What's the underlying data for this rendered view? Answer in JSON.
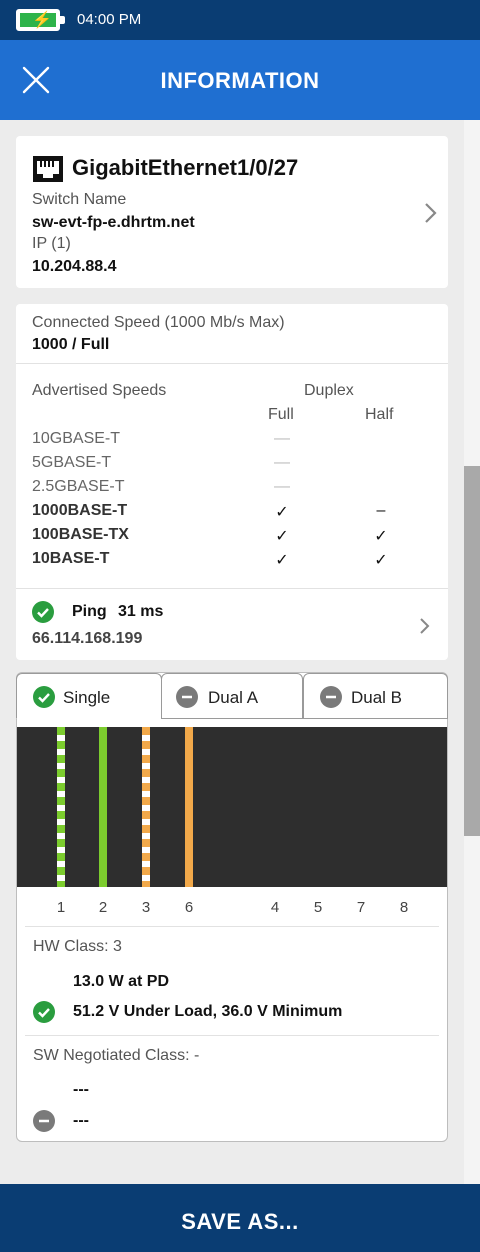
{
  "status_bar": {
    "time": "04:00 PM",
    "battery_icon": "battery-charging-icon"
  },
  "app_bar": {
    "title": "INFORMATION",
    "close_icon": "close-icon"
  },
  "port_card": {
    "port_name": "GigabitEthernet1/0/27",
    "switch_name_label": "Switch Name",
    "switch_name": "sw-evt-fp-e.dhrtm.net",
    "ip_label": "IP (1)",
    "ip": "10.204.88.4"
  },
  "speed_card": {
    "connected_speed_label": "Connected Speed (1000 Mb/s Max)",
    "connected_speed": "1000 / Full",
    "advertised_label": "Advertised Speeds",
    "duplex_label": "Duplex",
    "full_label": "Full",
    "half_label": "Half",
    "rows": [
      {
        "name": "10GBASE-T",
        "full": "—",
        "half": ""
      },
      {
        "name": "5GBASE-T",
        "full": "—",
        "half": ""
      },
      {
        "name": "2.5GBASE-T",
        "full": "—",
        "half": ""
      },
      {
        "name": "1000BASE-T",
        "full": "✓",
        "half": "–"
      },
      {
        "name": "100BASE-TX",
        "full": "✓",
        "half": "✓"
      },
      {
        "name": "10BASE-T",
        "full": "✓",
        "half": "✓"
      }
    ],
    "ping_label": "Ping",
    "ping_value": "31 ms",
    "ping_ip": "66.114.168.199"
  },
  "poe_card": {
    "tabs": [
      {
        "label": "Single",
        "status": "ok"
      },
      {
        "label": "Dual A",
        "status": "none"
      },
      {
        "label": "Dual B",
        "status": "none"
      }
    ],
    "pins": [
      "1",
      "2",
      "3",
      "6",
      "4",
      "5",
      "7",
      "8"
    ],
    "wire_colors": {
      "green": "#7ccc2e",
      "orange": "#f2a94a",
      "white": "#ffffff"
    },
    "hw_class_label": "HW Class: 3",
    "hw_power": "13.0 W at PD",
    "hw_voltage": "51.2 V Under Load, 36.0 V Minimum",
    "sw_class_label": "SW Negotiated Class: -",
    "sw_line1": "---",
    "sw_line2": "---"
  },
  "footer": {
    "save_label": "SAVE AS..."
  },
  "colors": {
    "status_bar": "#0a3d73",
    "app_bar": "#1f6fd1",
    "ok": "#2a9d3f",
    "neutral": "#7a7a7a"
  }
}
